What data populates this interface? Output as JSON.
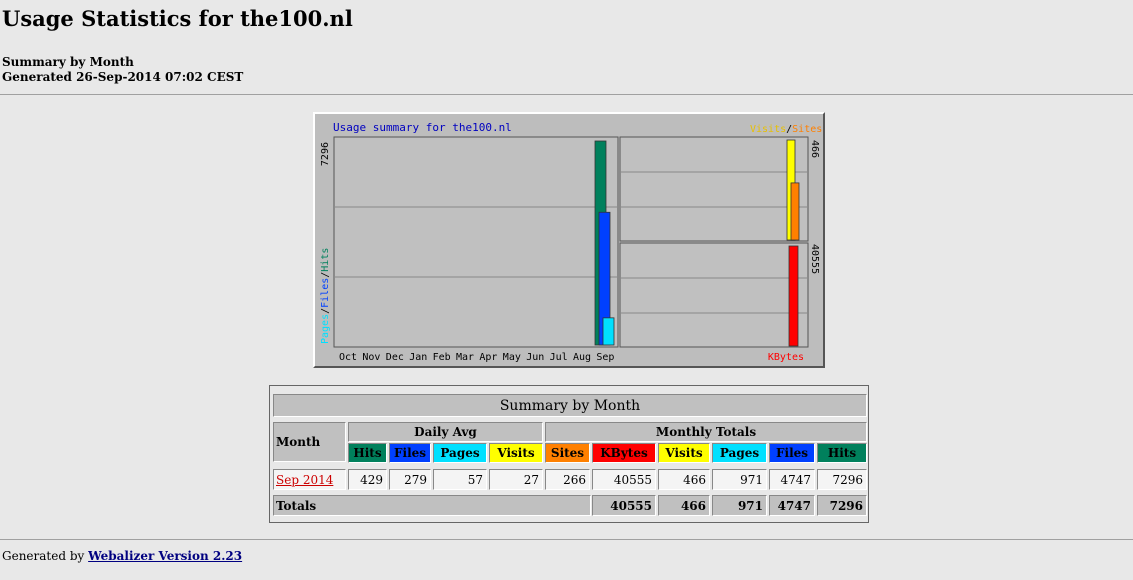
{
  "page": {
    "title": "Usage Statistics for the100.nl",
    "summary_label": "Summary by Month",
    "generated": "Generated 26-Sep-2014 07:02 CEST"
  },
  "graph": {
    "title": "Usage summary for the100.nl",
    "left_axis_label_parts": [
      "Pages",
      "/",
      "Files",
      "/",
      "Hits"
    ],
    "left_max": "7296",
    "right_top_legend": [
      "Visits",
      "/",
      "Sites"
    ],
    "right_top_max": "466",
    "right_bottom_max": "40555",
    "right_bottom_legend": "KBytes",
    "months": [
      "Oct",
      "Nov",
      "Dec",
      "Jan",
      "Feb",
      "Mar",
      "Apr",
      "May",
      "Jun",
      "Jul",
      "Aug",
      "Sep"
    ],
    "colors": {
      "hits": "#00805c",
      "files": "#0040ff",
      "pages": "#00e0ff",
      "visits": "#ffff00",
      "sites": "#ff8000",
      "kbytes": "#ff0000",
      "title": "#0000c0"
    }
  },
  "chart_data": {
    "type": "bar",
    "categories": [
      "Oct",
      "Nov",
      "Dec",
      "Jan",
      "Feb",
      "Mar",
      "Apr",
      "May",
      "Jun",
      "Jul",
      "Aug",
      "Sep"
    ],
    "title": "Usage summary for the100.nl",
    "series": [
      {
        "name": "Hits",
        "values": [
          0,
          0,
          0,
          0,
          0,
          0,
          0,
          0,
          0,
          0,
          0,
          7296
        ]
      },
      {
        "name": "Files",
        "values": [
          0,
          0,
          0,
          0,
          0,
          0,
          0,
          0,
          0,
          0,
          0,
          4747
        ]
      },
      {
        "name": "Pages",
        "values": [
          0,
          0,
          0,
          0,
          0,
          0,
          0,
          0,
          0,
          0,
          0,
          971
        ]
      },
      {
        "name": "Visits",
        "values": [
          0,
          0,
          0,
          0,
          0,
          0,
          0,
          0,
          0,
          0,
          0,
          466
        ]
      },
      {
        "name": "Sites",
        "values": [
          0,
          0,
          0,
          0,
          0,
          0,
          0,
          0,
          0,
          0,
          0,
          266
        ]
      },
      {
        "name": "KBytes",
        "values": [
          0,
          0,
          0,
          0,
          0,
          0,
          0,
          0,
          0,
          0,
          0,
          40555
        ]
      }
    ],
    "ylim_left": [
      0,
      7296
    ],
    "ylim_right_top": [
      0,
      466
    ],
    "ylim_right_bottom": [
      0,
      40555
    ],
    "grid": true
  },
  "table": {
    "title": "Summary by Month",
    "month_header": "Month",
    "daily_avg_header": "Daily Avg",
    "monthly_totals_header": "Monthly Totals",
    "columns": [
      "Hits",
      "Files",
      "Pages",
      "Visits",
      "Sites",
      "KBytes",
      "Visits",
      "Pages",
      "Files",
      "Hits"
    ],
    "column_colors": [
      "#00805c",
      "#0040ff",
      "#00e0ff",
      "#ffff00",
      "#ff8000",
      "#ff0000",
      "#ffff00",
      "#00e0ff",
      "#0040ff",
      "#00805c"
    ],
    "rows": [
      {
        "month": "Sep 2014",
        "values": [
          "429",
          "279",
          "57",
          "27",
          "266",
          "40555",
          "466",
          "971",
          "4747",
          "7296"
        ]
      }
    ],
    "totals_label": "Totals",
    "totals": [
      "40555",
      "466",
      "971",
      "4747",
      "7296"
    ]
  },
  "footer": {
    "prefix": "Generated by",
    "link": "Webalizer Version 2.23"
  }
}
